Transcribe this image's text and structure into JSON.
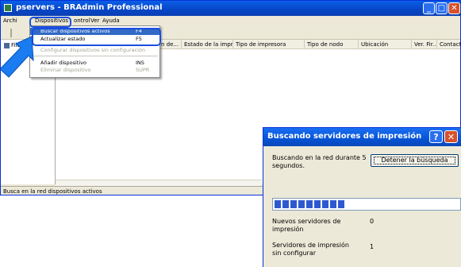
{
  "window": {
    "title": "pservers - BRAdmin Professional",
    "controls": {
      "minimize": "_",
      "maximize": "□",
      "close": "✕"
    }
  },
  "menubar": [
    "Archivo",
    "Dispositivos",
    "Control",
    "Ver",
    "Ayuda"
  ],
  "menubar_visible": [
    "Archi",
    "Dispositivos",
    "ontrol",
    "Ver",
    "Ayuda"
  ],
  "left_pane": {
    "filters_label": "Filtros"
  },
  "columns": [
    "n de...",
    "Estado de la impr...",
    "Tipo de impresora",
    "Tipo de nodo",
    "Ubicación",
    "Ver. Fir...",
    "Contacto"
  ],
  "dropdown": {
    "items": [
      {
        "label": "Buscar dispositivos activos",
        "shortcut": "F4",
        "state": "selected"
      },
      {
        "label": "Actualizar estado",
        "shortcut": "F5",
        "state": "normal"
      },
      {
        "label": "Configurar dispositivos sin configuración",
        "shortcut": "",
        "state": "disabled"
      },
      {
        "label": "Añadir dispositivo",
        "shortcut": "INS",
        "state": "normal"
      },
      {
        "label": "Eliminar dispositivo",
        "shortcut": "SUPR",
        "state": "disabled"
      }
    ]
  },
  "status_bar": "Busca en la red dispositivos activos",
  "dialog": {
    "title": "Buscando servidores de impresión",
    "help_label": "?",
    "close_label": "✕",
    "message": "Buscando en la red durante 5 segundos.",
    "stop_button": "Detener la búsqueda",
    "progress": {
      "segments_filled": 9
    },
    "stats": [
      {
        "label": "Nuevos servidores de impresión",
        "value": "0"
      },
      {
        "label": "Servidores de impresión sin configurar",
        "value": "1"
      }
    ]
  },
  "colors": {
    "titlebar": "#0747c8",
    "menu_highlight": "#316ac5",
    "callout": "#1b4fe0",
    "arrow": "#1a7cf0",
    "progress": "#2e58cf"
  }
}
